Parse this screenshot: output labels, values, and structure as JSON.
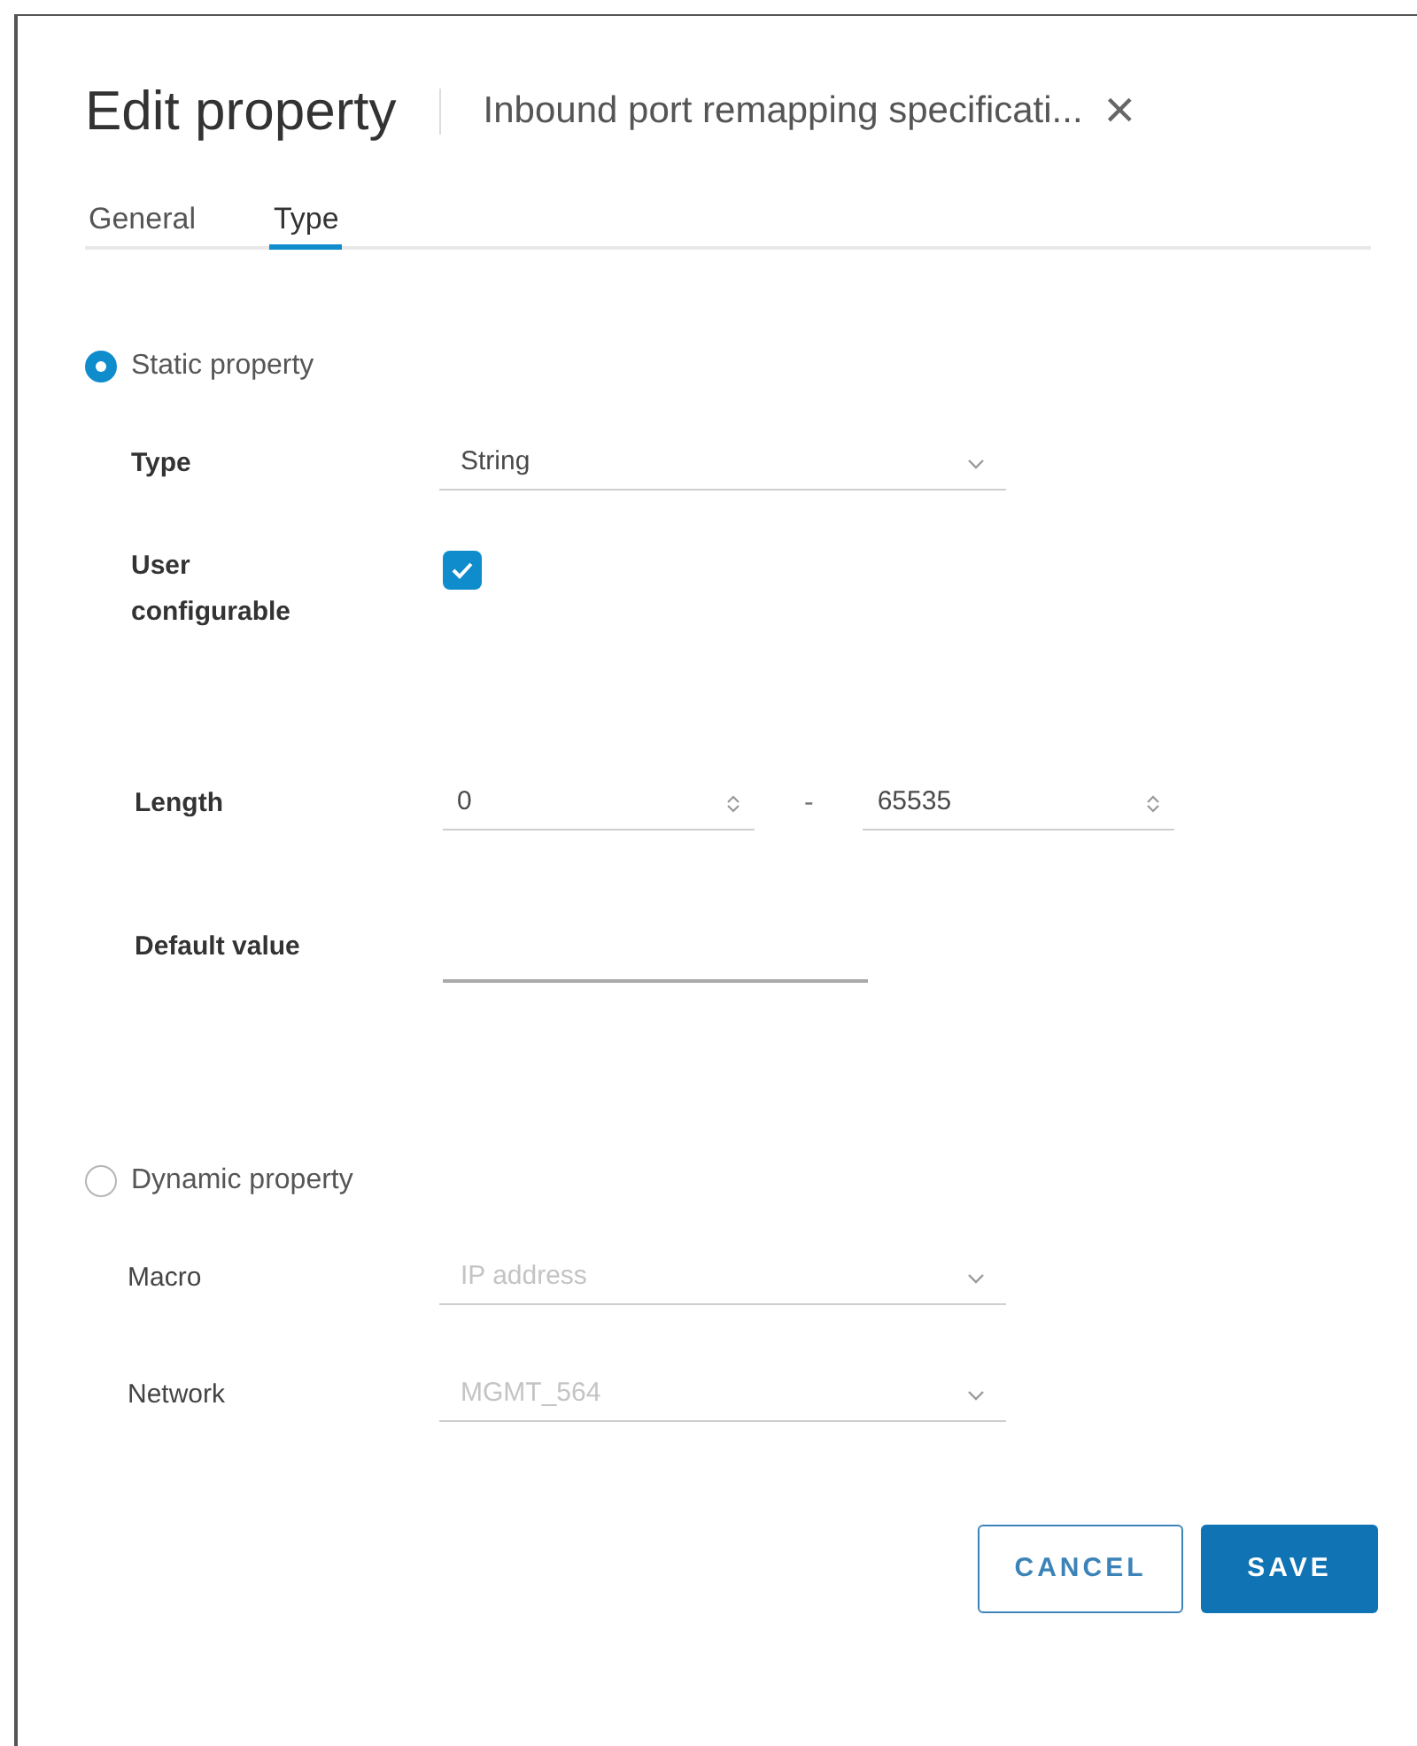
{
  "dialog": {
    "title": "Edit property",
    "subtitle": "Inbound port remapping specificati...",
    "close": "×"
  },
  "tabs": [
    {
      "label": "General",
      "selected": false
    },
    {
      "label": "Type",
      "selected": true
    }
  ],
  "static": {
    "label": "Static property",
    "selected": true,
    "type": {
      "label": "Type",
      "value": "String"
    },
    "user_configurable": {
      "label": "User configurable",
      "checked": true
    },
    "length": {
      "label": "Length",
      "min": "0",
      "separator": "-",
      "max": "65535"
    },
    "default_value": {
      "label": "Default value"
    }
  },
  "dynamic": {
    "label": "Dynamic property",
    "selected": false,
    "fields": [
      {
        "label": "Macro",
        "value": "IP address",
        "disabled": true
      },
      {
        "label": "Network",
        "value": "MGMT_564",
        "disabled": true
      }
    ]
  },
  "buttons": [
    {
      "label": "CANCEL",
      "kind": "outline"
    },
    {
      "label": "SAVE",
      "kind": "primary"
    }
  ]
}
